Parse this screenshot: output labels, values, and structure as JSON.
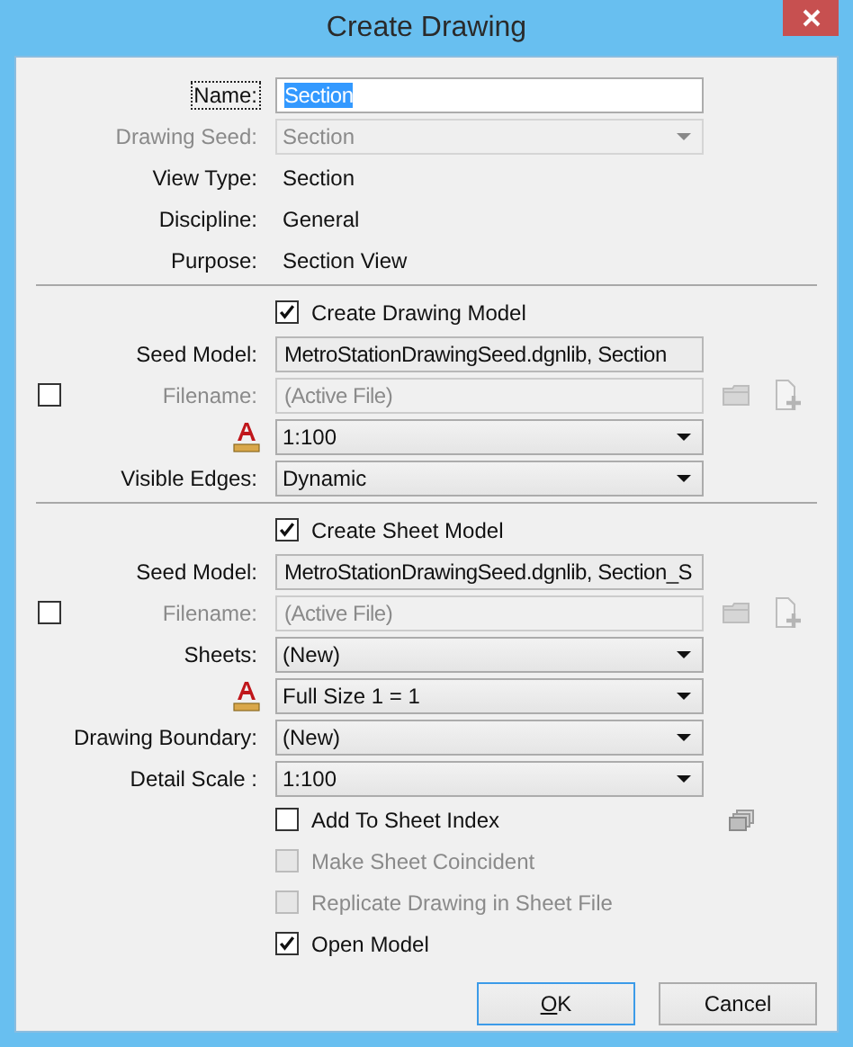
{
  "window": {
    "title": "Create Drawing"
  },
  "sections": [
    {
      "rows": [
        {
          "kind": "input",
          "label": "Name:",
          "value": "Section",
          "editable": true,
          "focused": true,
          "value_selected": true,
          "disabled": false
        },
        {
          "kind": "dropdown",
          "label": "Drawing Seed:",
          "value": "Section",
          "disabled": true
        },
        {
          "kind": "static",
          "label": "View Type:",
          "value": "Section",
          "disabled": false
        },
        {
          "kind": "static",
          "label": "Discipline:",
          "value": "General",
          "disabled": false
        },
        {
          "kind": "static",
          "label": "Purpose:",
          "value": "Section View",
          "disabled": false
        }
      ]
    },
    {
      "rows": [
        {
          "kind": "checkbox",
          "label": "Create Drawing Model",
          "checked": true,
          "disabled": false
        },
        {
          "kind": "input",
          "label": "Seed Model:",
          "value": "MetroStationDrawingSeed.dgnlib, Section",
          "editable": false,
          "focused": false,
          "value_selected": false,
          "disabled": false
        },
        {
          "kind": "file",
          "label": "Filename:",
          "value": "(Active File)",
          "checked": false,
          "disabled": true
        },
        {
          "kind": "scale-dropdown",
          "value": "1:100",
          "disabled": false
        },
        {
          "kind": "dropdown",
          "label": "Visible Edges:",
          "value": "Dynamic",
          "disabled": false
        }
      ]
    },
    {
      "rows": [
        {
          "kind": "checkbox",
          "label": "Create Sheet Model",
          "checked": true,
          "disabled": false
        },
        {
          "kind": "input",
          "label": "Seed Model:",
          "value": "MetroStationDrawingSeed.dgnlib, Section_S",
          "editable": false,
          "focused": false,
          "value_selected": false,
          "disabled": false
        },
        {
          "kind": "file",
          "label": "Filename:",
          "value": "(Active File)",
          "checked": false,
          "disabled": true
        },
        {
          "kind": "dropdown",
          "label": "Sheets:",
          "value": "(New)",
          "disabled": false
        },
        {
          "kind": "scale-dropdown",
          "value": "Full Size 1 = 1",
          "disabled": false
        },
        {
          "kind": "dropdown",
          "label": "Drawing Boundary:",
          "value": "(New)",
          "disabled": false
        },
        {
          "kind": "dropdown",
          "label": "Detail Scale :",
          "value": "1:100",
          "disabled": false
        },
        {
          "kind": "index-checkbox",
          "label": "Add To Sheet Index",
          "checked": false,
          "disabled": false
        },
        {
          "kind": "checkbox",
          "label": "Make Sheet Coincident",
          "checked": false,
          "disabled": true
        },
        {
          "kind": "checkbox",
          "label": "Replicate Drawing in Sheet File",
          "checked": false,
          "disabled": true
        },
        {
          "kind": "checkbox",
          "label": "Open Model",
          "checked": true,
          "disabled": false
        }
      ]
    }
  ],
  "buttons": [
    {
      "label": "OK",
      "default": true,
      "mnemonic": true
    },
    {
      "label": "Cancel",
      "default": false,
      "mnemonic": false
    }
  ]
}
